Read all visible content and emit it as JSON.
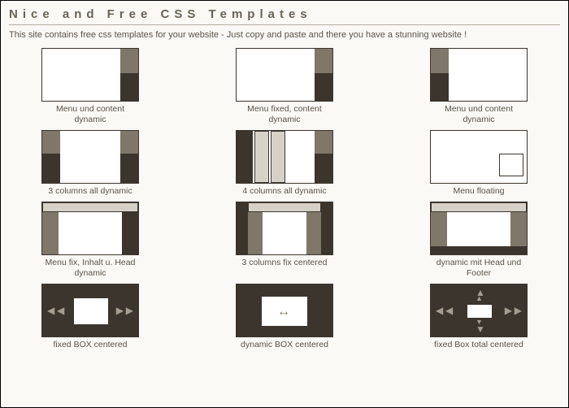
{
  "page_title": "Nice and Free CSS Templates",
  "intro": "This site contains free css templates for your website - Just copy and paste and there you have a stunning website !",
  "templates": {
    "r0c0": "Menu und content dynamic",
    "r0c1": "Menu fixed, content dynamic",
    "r0c2": "Menu und content dynamic",
    "r1c0": "3 columns all dynamic",
    "r1c1": "4 columns all dynamic",
    "r1c2": "Menu floating",
    "r2c0": "Menu fix, Inhalt u. Head dynamic",
    "r2c1": "3 columns fix centered",
    "r2c2": "dynamic mit Head und Footer",
    "r3c0": "fixed BOX centered",
    "r3c1": "dynamic BOX centered",
    "r3c2": "fixed Box total centered"
  }
}
